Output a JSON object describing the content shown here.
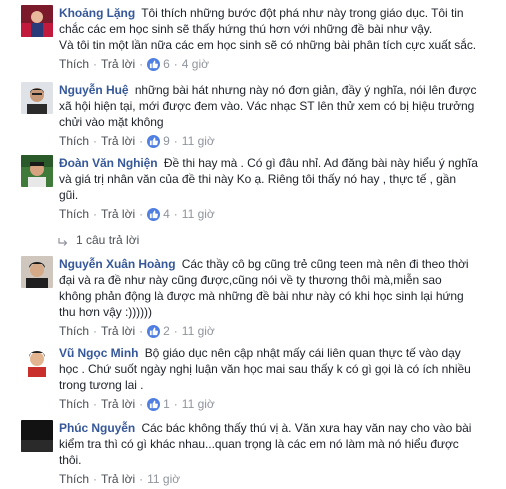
{
  "labels": {
    "like": "Thích",
    "reply": "Trả lời",
    "sep": "·"
  },
  "comments": [
    {
      "author": "Khoảng Lặng",
      "lines": [
        "Tôi thích những bước đột phá như này trong giáo dục. Tôi tin",
        "chắc các em học sinh sẽ thấy hứng thú hơn với những đề bài như vậy.",
        "Và tôi tin một lần nữa các em học sinh sẽ có những bài phân tích cực xuất sắc."
      ],
      "likes": "6",
      "time": "4 giờ"
    },
    {
      "author": "Nguyễn Huệ",
      "lines": [
        "những bài hát nhưng này nó đơn giản, đầy ý nghĩa, nói lên được",
        "xã hội hiện tại, mới được đem vào. Vác nhạc ST lên thử xem có bị hiệu trưởng",
        "chửi vào mặt không"
      ],
      "likes": "9",
      "time": "11 giờ"
    },
    {
      "author": "Đoàn Văn Nghiện",
      "lines": [
        "Đề thi hay mà . Có gì đâu nhỉ. Ad đăng bài này hiểu ý nghĩa",
        "và giá trị nhân văn của đề thi này Ko ạ. Riêng tôi thấy nó hay , thực tế , gần",
        "gũi."
      ],
      "likes": "4",
      "time": "11 giờ",
      "replies_label": "1 câu trả lời"
    },
    {
      "author": "Nguyễn Xuân Hoàng",
      "lines": [
        "Các thầy cô bg cũng trẻ cũng teen mà nên đi theo thời",
        "đại và ra đề như này cũng được,cũng nói về ty thương thôi mà,miễn sao",
        "không phản động là được mà những đề bài như này có khi học sinh lại hứng",
        "thu hơn vậy :))))))"
      ],
      "likes": "2",
      "time": "11 giờ"
    },
    {
      "author": "Vũ Ngọc Minh",
      "lines": [
        "Bộ giáo dục nên cập nhật mấy cái liên quan thực tế vào dạy",
        "học . Chứ suốt ngày nghị luận văn học mai sau thấy k có gì gọi là có ích nhiều",
        "trong tương lai ."
      ],
      "likes": "1",
      "time": "11 giờ"
    },
    {
      "author": "Phúc Nguyễn",
      "lines": [
        "Các bác không thấy thú vị à. Văn xưa hay văn nay cho vào bài",
        "kiểm tra thì có gì khác nhau...quan trọng là các em nó làm mà nó hiểu được",
        "thôi."
      ],
      "likes": "",
      "time": "11 giờ"
    }
  ]
}
